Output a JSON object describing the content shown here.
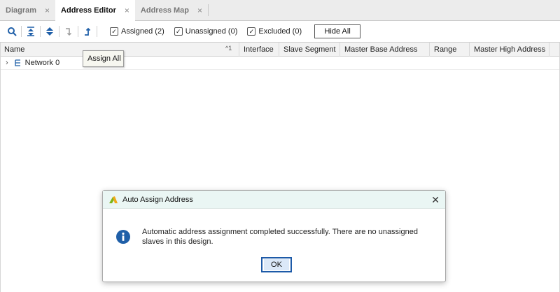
{
  "tabs": [
    {
      "label": "Diagram",
      "active": false
    },
    {
      "label": "Address Editor",
      "active": true
    },
    {
      "label": "Address Map",
      "active": false
    }
  ],
  "toolbar": {
    "icons": [
      "search-icon",
      "collapse-all-icon",
      "expand-all-icon",
      "unassign-icon",
      "assign-all-icon"
    ],
    "checkboxes": [
      {
        "label": "Assigned (2)",
        "checked": true
      },
      {
        "label": "Unassigned (0)",
        "checked": true
      },
      {
        "label": "Excluded (0)",
        "checked": true
      }
    ],
    "hide_all_label": "Hide All"
  },
  "grid": {
    "columns": [
      "Name",
      "Interface",
      "Slave Segment",
      "Master Base Address",
      "Range",
      "Master High Address"
    ],
    "sort_indicator": "^1",
    "rows": [
      {
        "name": "Network 0"
      }
    ]
  },
  "tooltip": {
    "text": "Assign All"
  },
  "dialog": {
    "title": "Auto Assign Address",
    "message": "Automatic address assignment completed successfully. There are no unassigned slaves in this design.",
    "ok_label": "OK"
  },
  "colors": {
    "dialog_title_bg": "#eaf6f4",
    "info_icon": "#1f5fa8",
    "ok_border": "#1d5aa8"
  }
}
